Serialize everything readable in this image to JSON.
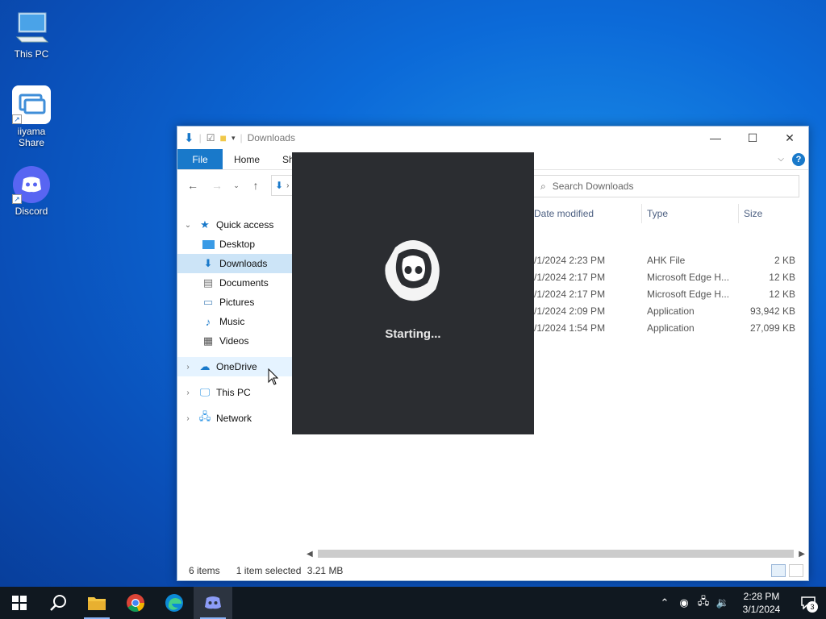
{
  "desktop": {
    "icons": [
      {
        "label": "This PC",
        "icon": "computer-icon"
      },
      {
        "label": "iiyama Share",
        "icon": "share-app-icon"
      },
      {
        "label": "Discord",
        "icon": "discord-icon"
      }
    ]
  },
  "explorer": {
    "title": "Downloads",
    "ribbon_tabs": {
      "file": "File",
      "home": "Home",
      "share": "Sh"
    },
    "search_placeholder": "Search Downloads",
    "nav": {
      "quick_access": "Quick access",
      "desktop": "Desktop",
      "downloads": "Downloads",
      "documents": "Documents",
      "pictures": "Pictures",
      "music": "Music",
      "videos": "Videos",
      "onedrive": "OneDrive",
      "this_pc": "This PC",
      "network": "Network"
    },
    "columns": {
      "date": "Date modified",
      "type": "Type",
      "size": "Size"
    },
    "rows": [
      {
        "date": "/1/2024 2:23 PM",
        "type": "AHK File",
        "size": "2 KB"
      },
      {
        "date": "/1/2024 2:17 PM",
        "type": "Microsoft Edge H...",
        "size": "12 KB"
      },
      {
        "date": "/1/2024 2:17 PM",
        "type": "Microsoft Edge H...",
        "size": "12 KB"
      },
      {
        "date": "/1/2024 2:09 PM",
        "type": "Application",
        "size": "93,942 KB"
      },
      {
        "date": "/1/2024 1:54 PM",
        "type": "Application",
        "size": "27,099 KB"
      }
    ],
    "status": {
      "items": "6 items",
      "selected": "1 item selected",
      "size": "3.21 MB"
    }
  },
  "splash": {
    "text": "Starting..."
  },
  "taskbar": {
    "time": "2:28 PM",
    "date": "3/1/2024",
    "notification_count": "3"
  },
  "colors": {
    "accent": "#1979ca",
    "splash_bg": "#2b2d31",
    "discord": "#5865f2"
  }
}
